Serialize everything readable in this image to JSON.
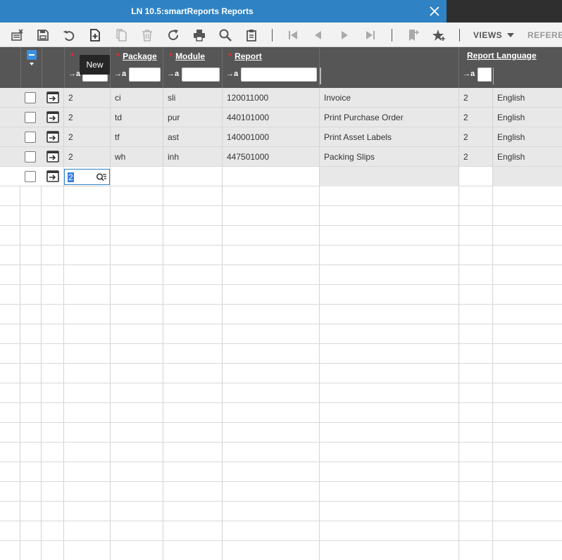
{
  "window": {
    "title": "LN 10.5:smartReports Reports"
  },
  "toolbar": {
    "views_label": "VIEWS",
    "references_label": "REFERE"
  },
  "tooltip": {
    "text": "New"
  },
  "grid": {
    "columns": [
      {
        "label": "",
        "required": true
      },
      {
        "label": "Package",
        "required": true
      },
      {
        "label": "Module",
        "required": true
      },
      {
        "label": "Report",
        "required": true
      },
      {
        "label": "",
        "required": false
      },
      {
        "label": "Report Language",
        "required": false
      }
    ],
    "filter_prefix": "→a",
    "rows": [
      {
        "c0": "2",
        "package": "ci",
        "module": "sli",
        "report": "120011000",
        "description": "Invoice",
        "lang_code": "2",
        "language": "English"
      },
      {
        "c0": "2",
        "package": "td",
        "module": "pur",
        "report": "440101000",
        "description": "Print Purchase Order",
        "lang_code": "2",
        "language": "English"
      },
      {
        "c0": "2",
        "package": "tf",
        "module": "ast",
        "report": "140001000",
        "description": "Print Asset Labels",
        "lang_code": "2",
        "language": "English"
      },
      {
        "c0": "2",
        "package": "wh",
        "module": "inh",
        "report": "447501000",
        "description": "Packing Slips",
        "lang_code": "2",
        "language": "English"
      }
    ],
    "new_row": {
      "editing_value": "2"
    }
  },
  "colors": {
    "title_tab": "#2f83c4",
    "header_bg": "#565656",
    "required_star": "#e32a2a",
    "selection": "#3a7ee0"
  }
}
